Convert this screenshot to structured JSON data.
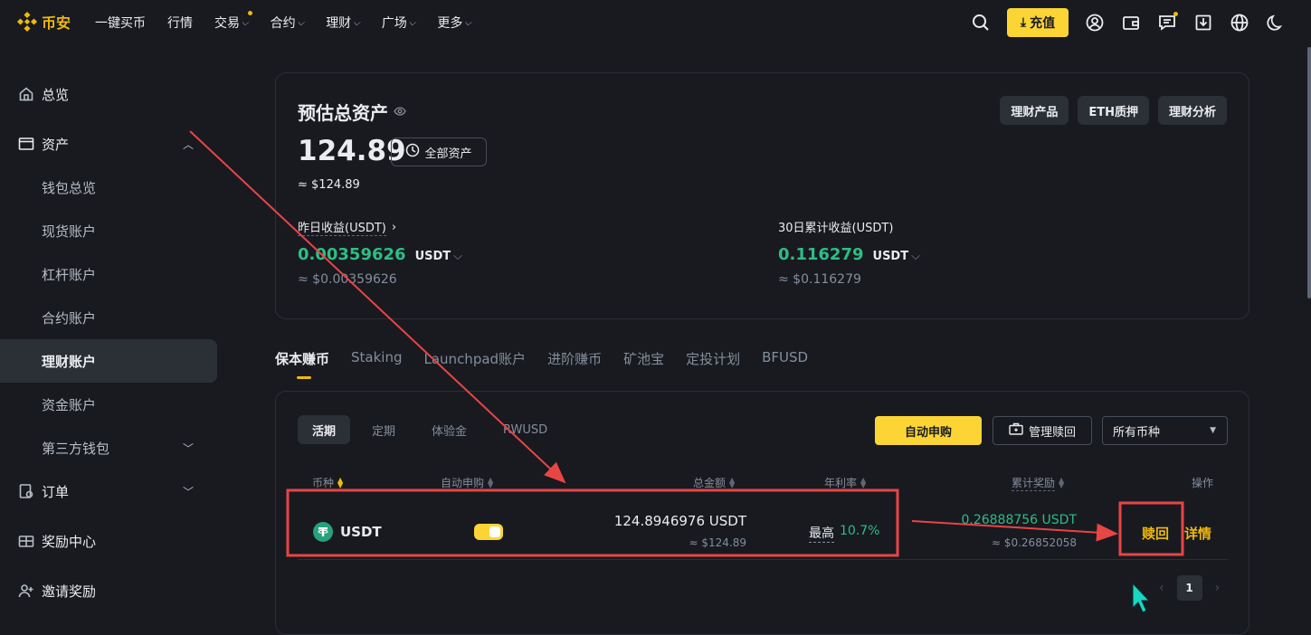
{
  "brand": {
    "name": "币安",
    "color": "#f0b90b"
  },
  "nav": {
    "items": [
      {
        "label": "一键买币",
        "has_chevron": false
      },
      {
        "label": "行情",
        "has_chevron": false
      },
      {
        "label": "交易",
        "has_chevron": true
      },
      {
        "label": "合约",
        "has_chevron": true
      },
      {
        "label": "理财",
        "has_chevron": true
      },
      {
        "label": "广场",
        "has_chevron": true
      },
      {
        "label": "更多",
        "has_chevron": true
      }
    ],
    "deposit_label": "充值",
    "icons": [
      "search-icon",
      "user-icon",
      "wallet-icon",
      "message-icon",
      "download-icon",
      "globe-icon",
      "moon-icon"
    ]
  },
  "sidebar": {
    "items": [
      {
        "label": "总览",
        "icon": "home-icon"
      },
      {
        "label": "资产",
        "icon": "wallet-icon"
      },
      {
        "label": "钱包总览"
      },
      {
        "label": "现货账户"
      },
      {
        "label": "杠杆账户"
      },
      {
        "label": "合约账户"
      },
      {
        "label": "理财账户"
      },
      {
        "label": "资金账户"
      },
      {
        "label": "第三方钱包"
      },
      {
        "label": "订单",
        "icon": "order-icon"
      },
      {
        "label": "奖励中心",
        "icon": "reward-icon"
      },
      {
        "label": "邀请奖励",
        "icon": "invite-icon"
      }
    ]
  },
  "summary": {
    "title": "预估总资产",
    "total": "124.89",
    "all_assets_label": "全部资产",
    "approx_usd": "≈ $124.89",
    "buttons": [
      "理财产品",
      "ETH质押",
      "理财分析"
    ],
    "yesterday": {
      "label": "昨日收益(USDT)",
      "value": "0.00359626",
      "unit": "USDT",
      "usd": "≈ $0.00359626"
    },
    "month": {
      "label": "30日累计收益(USDT)",
      "value": "0.116279",
      "unit": "USDT",
      "usd": "≈ $0.116279"
    }
  },
  "product_tabs": [
    "保本赚币",
    "Staking",
    "Launchpad账户",
    "进阶赚币",
    "矿池宝",
    "定投计划",
    "BFUSD"
  ],
  "earn": {
    "subtabs": [
      "活期",
      "定期",
      "体验金",
      "RWUSD"
    ],
    "auto_subscribe_label": "自动申购",
    "manage_redeem_label": "管理赎回",
    "coin_filter": "所有币种",
    "headers": {
      "coin": "币种",
      "auto": "自动申购",
      "total": "总金额",
      "apr": "年利率",
      "rewards": "累计奖励",
      "action": "操作"
    },
    "row": {
      "coin": "USDT",
      "auto_on": true,
      "total": "124.8946976 USDT",
      "total_usd": "≈ $124.89",
      "apr_label": "最高",
      "apr_value": "10.7%",
      "rewards": "0.26888756 USDT",
      "rewards_usd": "≈ $0.26852058",
      "redeem_label": "赎回",
      "detail_label": "详情"
    },
    "page": "1"
  }
}
